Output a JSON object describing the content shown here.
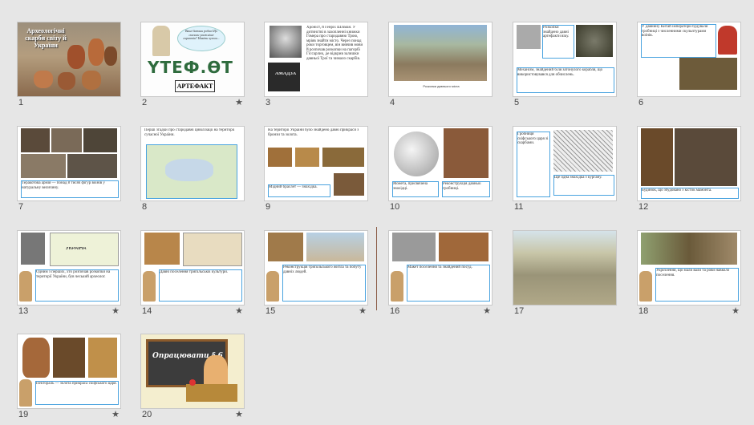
{
  "slides": [
    {
      "number": "1",
      "title": "Археологічні скарби світу й України",
      "starred": false
    },
    {
      "number": "2",
      "word": "ҮТЕФ.ӨТ",
      "label": "АРТЕФАКТ",
      "bubble": "Ваші батьки робив Що сказали уважніше скриптів? Навіть чуючи...",
      "starred": true
    },
    {
      "number": "3",
      "book_title": "АМАДЗА",
      "starred": false
    },
    {
      "number": "4",
      "starred": false
    },
    {
      "number": "5",
      "starred": false
    },
    {
      "number": "6",
      "starred": false
    },
    {
      "number": "7",
      "starred": false
    },
    {
      "number": "8",
      "starred": false
    },
    {
      "number": "9",
      "starred": false
    },
    {
      "number": "10",
      "starred": false
    },
    {
      "number": "11",
      "starred": false
    },
    {
      "number": "12",
      "starred": false
    },
    {
      "number": "13",
      "country": "УКРАЇНА",
      "starred": true
    },
    {
      "number": "14",
      "starred": true
    },
    {
      "number": "15",
      "starred": true
    },
    {
      "number": "16",
      "starred": true
    },
    {
      "number": "17",
      "starred": false
    },
    {
      "number": "18",
      "starred": true
    },
    {
      "number": "19",
      "starred": true
    },
    {
      "number": "20",
      "board_text": "Опрацювати § 6",
      "starred": true
    }
  ],
  "star_glyph": "★"
}
